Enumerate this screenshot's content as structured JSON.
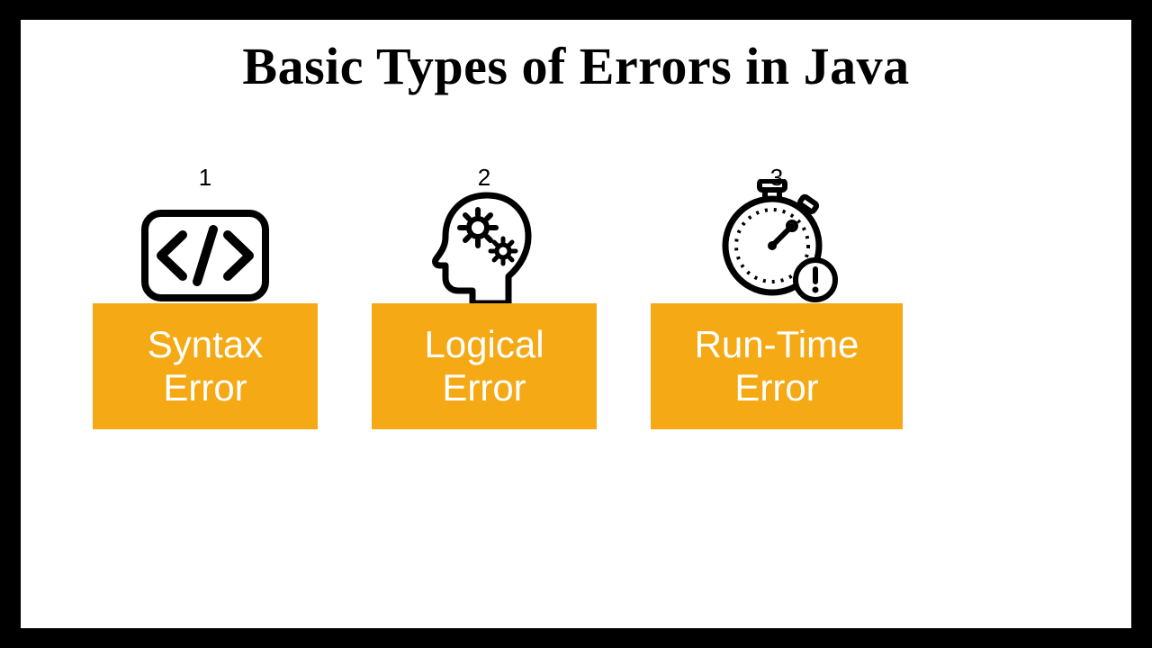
{
  "title": "Basic Types of Errors in Java",
  "items": [
    {
      "number": "1",
      "line1": "Syntax",
      "line2": "Error",
      "icon": "code-tag-icon"
    },
    {
      "number": "2",
      "line1": "Logical",
      "line2": "Error",
      "icon": "head-gears-icon"
    },
    {
      "number": "3",
      "line1": "Run-Time",
      "line2": "Error",
      "icon": "stopwatch-alert-icon"
    }
  ],
  "colors": {
    "accent": "#f4a915",
    "text": "#ffffff"
  }
}
